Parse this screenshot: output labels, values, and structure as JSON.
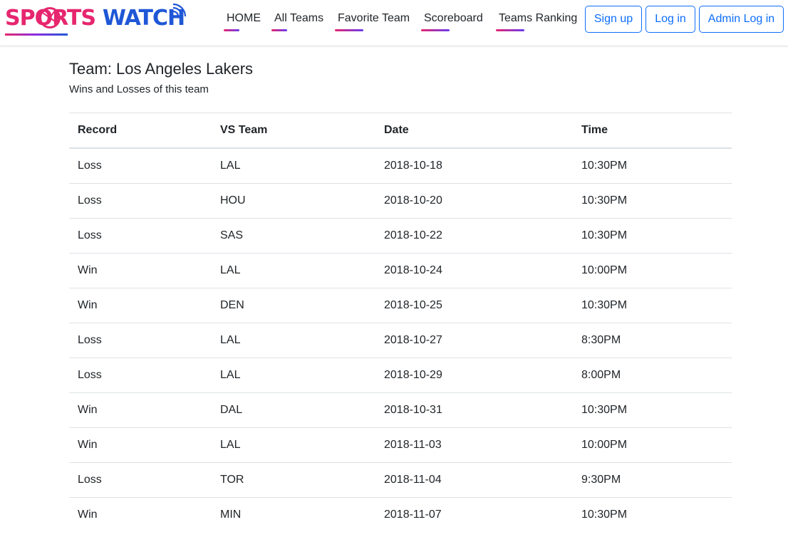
{
  "brand": {
    "part1": "SPORTS",
    "part2": "WATCH",
    "colors": {
      "sports": "#e6266e",
      "watch": "#1f57d6"
    }
  },
  "nav": {
    "items": [
      {
        "label": "HOME"
      },
      {
        "label": "All Teams"
      },
      {
        "label": "Favorite Team"
      },
      {
        "label": "Scoreboard"
      },
      {
        "label": "Teams Ranking"
      }
    ]
  },
  "auth": {
    "signup_label": "Sign up",
    "login_label": "Log in",
    "admin_login_label": "Admin Log in"
  },
  "page": {
    "title": "Team: Los Angeles Lakers",
    "subtitle": "Wins and Losses of this team"
  },
  "table": {
    "headers": [
      "Record",
      "VS Team",
      "Date",
      "Time"
    ],
    "rows": [
      [
        "Loss",
        "LAL",
        "2018-10-18",
        "10:30PM"
      ],
      [
        "Loss",
        "HOU",
        "2018-10-20",
        "10:30PM"
      ],
      [
        "Loss",
        "SAS",
        "2018-10-22",
        "10:30PM"
      ],
      [
        "Win",
        "LAL",
        "2018-10-24",
        "10:00PM"
      ],
      [
        "Win",
        "DEN",
        "2018-10-25",
        "10:30PM"
      ],
      [
        "Loss",
        "LAL",
        "2018-10-27",
        "8:30PM"
      ],
      [
        "Loss",
        "LAL",
        "2018-10-29",
        "8:00PM"
      ],
      [
        "Win",
        "DAL",
        "2018-10-31",
        "10:30PM"
      ],
      [
        "Win",
        "LAL",
        "2018-11-03",
        "10:00PM"
      ],
      [
        "Loss",
        "TOR",
        "2018-11-04",
        "9:30PM"
      ],
      [
        "Win",
        "MIN",
        "2018-11-07",
        "10:30PM"
      ]
    ]
  },
  "colors": {
    "accent": "#0d6efd",
    "border": "#dee2e6",
    "text": "#212529"
  }
}
